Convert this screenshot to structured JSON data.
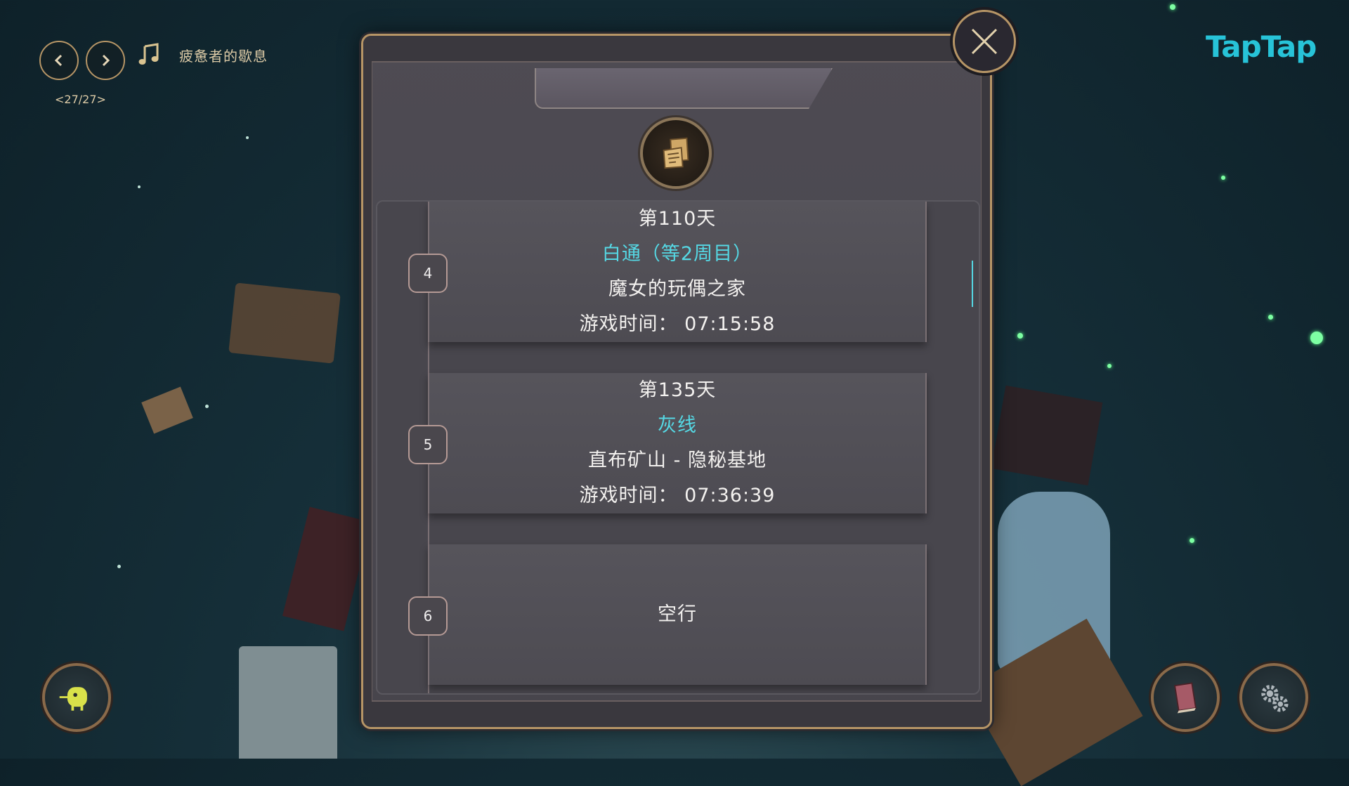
{
  "music": {
    "track_title": "疲惫者的歇息",
    "track_index": "<27/27>",
    "prev_icon": "chevron-left-icon",
    "next_icon": "chevron-right-icon",
    "note_icon": "music-note-icon"
  },
  "brand": {
    "logo_text": "TapTap",
    "color": "#27c3d8"
  },
  "panel": {
    "close_icon": "close-icon",
    "badge_icon": "scroll-letters-icon",
    "slots": [
      {
        "number": "4",
        "day": "第110天",
        "route": "白通（等2周目）",
        "location": "魔女的玩偶之家",
        "playtime": "游戏时间：  07:15:58"
      },
      {
        "number": "5",
        "day": "第135天",
        "route": "灰线",
        "location": "直布矿山 - 隐秘基地",
        "playtime": "游戏时间：  07:36:39"
      },
      {
        "number": "6",
        "empty": "空行"
      }
    ]
  },
  "corner_buttons": {
    "left_icon": "yellow-creature-icon",
    "book_icon": "book-icon",
    "settings_icon": "gear-icon"
  },
  "colors": {
    "accent_route": "#55d8e4",
    "frame_gold": "#b69566",
    "panel_bg": "#4e4b53"
  }
}
